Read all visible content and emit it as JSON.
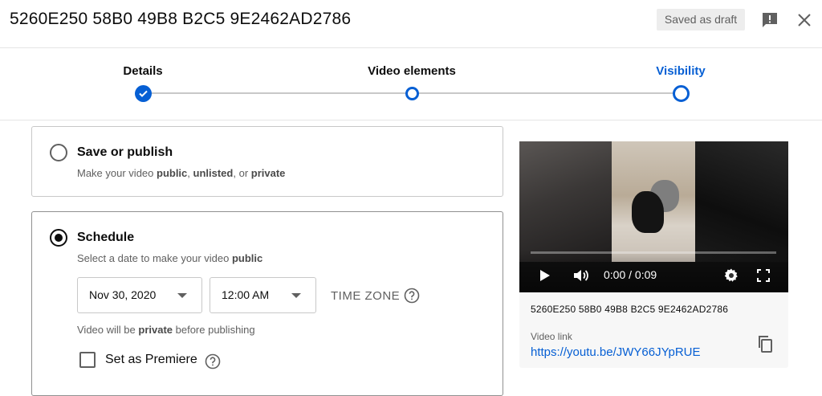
{
  "header": {
    "title": "5260E250 58B0 49B8 B2C5 9E2462AD2786",
    "draft_badge": "Saved as draft",
    "feedback_icon": "feedback-icon",
    "close_icon": "close-icon"
  },
  "stepper": {
    "steps": [
      {
        "label": "Details",
        "state": "completed"
      },
      {
        "label": "Video elements",
        "state": "incomplete"
      },
      {
        "label": "Visibility",
        "state": "current"
      }
    ],
    "accent_color": "#065fd4"
  },
  "save_publish": {
    "title": "Save or publish",
    "sub_prefix": "Make your video ",
    "sub_public": "public",
    "sub_sep1": ", ",
    "sub_unlisted": "unlisted",
    "sub_sep2": ", or ",
    "sub_private": "private",
    "selected": false
  },
  "schedule": {
    "title": "Schedule",
    "sub_prefix": "Select a date to make your video ",
    "sub_public": "public",
    "selected": true,
    "date_value": "Nov 30, 2020",
    "time_value": "12:00 AM",
    "timezone_label": "TIME ZONE",
    "note_prefix": "Video will be ",
    "note_private": "private",
    "note_suffix": " before publishing",
    "premiere_label": "Set as Premiere",
    "premiere_checked": false
  },
  "preview": {
    "time_display": "0:00 / 0:09",
    "progress": 0.0,
    "video_title": "5260E250 58B0 49B8 B2C5 9E2462AD2786",
    "link_label": "Video link",
    "link_url": "https://youtu.be/JWY66JYpRUE",
    "icons": [
      "play-icon",
      "volume-icon",
      "settings-icon",
      "fullscreen-icon",
      "copy-icon"
    ]
  }
}
